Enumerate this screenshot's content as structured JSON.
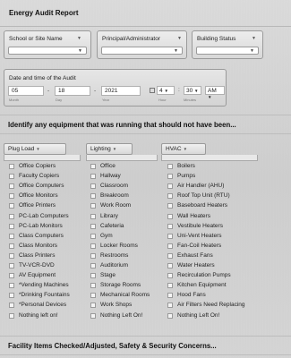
{
  "title": "Energy Audit Report",
  "fields": {
    "school": "School or Site Name",
    "admin": "Principal/Administrator",
    "status": "Building Status"
  },
  "datetime": {
    "label": "Date and time of the Audit",
    "month": "05",
    "day": "18",
    "year": "2021",
    "hour": "4",
    "minute": "30",
    "ampm": "AM",
    "month_label": "Month",
    "day_label": "Day",
    "year_label": "Year",
    "hour_label": "Hour",
    "minute_label": "Minutes"
  },
  "section1": "Identify any equipment that was running that should not have been...",
  "section2": "Facility Items Checked/Adjusted, Safety & Security Concerns...",
  "columns": {
    "plug": "Plug Load",
    "lighting": "Lighting",
    "hvac": "HVAC"
  },
  "plug_items": [
    "Office Copiers",
    "Faculty Copiers",
    "Office Computers",
    "Office Monitors",
    "Office Printers",
    "PC-Lab Computers",
    "PC-Lab Monitors",
    "Class Computers",
    "Class Monitors",
    "Class Printers",
    "TV-VCR-DVD",
    "AV Equipment",
    "*Vending Machines",
    "*Drinking Fountains",
    "*Personal Devices",
    "Nothing left on!"
  ],
  "lighting_items": [
    "Office",
    "Hallway",
    "Classroom",
    "Breakroom",
    "Work Room",
    "Library",
    "Cafeteria",
    "Gym",
    "Locker Rooms",
    "Restrooms",
    "Auditorium",
    "Stage",
    "Storage Rooms",
    "Mechanical Rooms",
    "Work Shops",
    "Nothing Left On!"
  ],
  "hvac_items": [
    "Boilers",
    "Pumps",
    "Air Handler (AHU)",
    "Roof Top Unit (RTU)",
    "Baseboard Heaters",
    "Wall Heaters",
    "Vestibule Heaters",
    "Uni-Vent Heaters",
    "Fan-Coil Heaters",
    "Exhaust Fans",
    "Water Heaters",
    "Recirculation Pumps",
    "Kitchen Equipment",
    "Hood Fans",
    "Air Filters Need Replacing",
    "Nothing Left On!"
  ]
}
